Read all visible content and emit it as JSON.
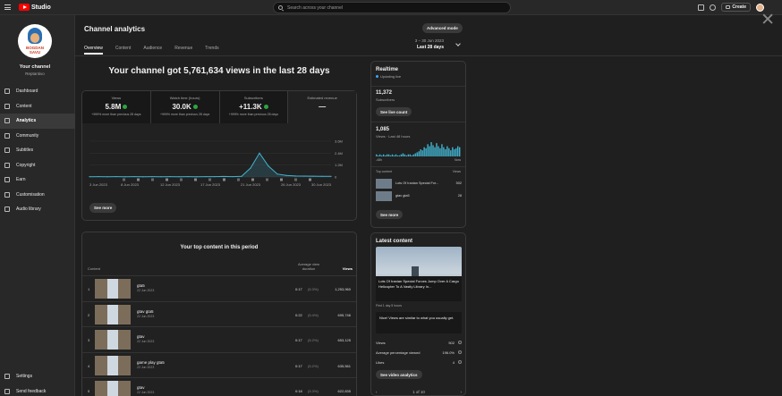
{
  "app": {
    "logo_text": "Studio",
    "search_placeholder": "Search across your channel",
    "create_label": "Create",
    "brand_color": "#ff0000"
  },
  "sidebar": {
    "avatar_text_line1": "BOGDAN",
    "avatar_text_line2": "SAVU",
    "your_channel": "Your channel",
    "channel_name": "Reptantivo",
    "items": [
      {
        "label": "Dashboard",
        "icon": "dashboard-icon"
      },
      {
        "label": "Content",
        "icon": "content-icon"
      },
      {
        "label": "Analytics",
        "icon": "analytics-icon",
        "active": true
      },
      {
        "label": "Community",
        "icon": "community-icon"
      },
      {
        "label": "Subtitles",
        "icon": "subtitles-icon"
      },
      {
        "label": "Copyright",
        "icon": "copyright-icon"
      },
      {
        "label": "Earn",
        "icon": "earn-icon"
      },
      {
        "label": "Customisation",
        "icon": "customisation-icon"
      },
      {
        "label": "Audio library",
        "icon": "audio-library-icon"
      }
    ],
    "bottom_items": [
      {
        "label": "Settings",
        "icon": "settings-icon"
      },
      {
        "label": "Send feedback",
        "icon": "feedback-icon"
      }
    ]
  },
  "main": {
    "title": "Channel analytics",
    "tabs": [
      "Overview",
      "Content",
      "Audience",
      "Revenue",
      "Trends"
    ],
    "advanced_mode": "Advanced mode",
    "date_range": "3 – 30 Jun 2023",
    "date_label": "Last 28 days",
    "headline": "Your channel got 5,761,634 views in the last 28 days",
    "metrics": [
      {
        "label": "Views",
        "value": "5.8M",
        "sub": "+999% more than previous 28 days"
      },
      {
        "label": "Watch time (hours)",
        "value": "30.0K",
        "sub": "+999% more than previous 28 days"
      },
      {
        "label": "Subscribers",
        "value": "+11.3K",
        "sub": "+999% more than previous 28 days"
      },
      {
        "label": "Estimated revenue",
        "value": "—",
        "sub": ""
      }
    ],
    "see_more": "See more"
  },
  "chart_data": {
    "type": "line",
    "x_ticks": [
      "3 Jun 2023",
      "8 Jun 2023",
      "12 Jun 2023",
      "17 Jun 2023",
      "21 Jun 2023",
      "26 Jun 2023",
      "30 Jun 2023"
    ],
    "y_ticks": [
      "0",
      "1.2M",
      "2.4M",
      "3.6M"
    ],
    "ylim": [
      0,
      3600000
    ],
    "x": [
      1,
      2,
      3,
      4,
      5,
      6,
      7,
      8,
      9,
      10,
      11,
      12,
      13,
      14,
      15,
      16,
      17,
      18,
      19,
      20,
      21,
      22,
      23,
      24,
      25,
      26,
      27,
      28
    ],
    "values": [
      30000,
      40000,
      30000,
      40000,
      30000,
      40000,
      30000,
      40000,
      30000,
      40000,
      30000,
      40000,
      30000,
      40000,
      40000,
      50000,
      40000,
      60000,
      900000,
      2400000,
      1100000,
      300000,
      150000,
      100000,
      90000,
      80000,
      70000,
      60000
    ],
    "series_color": "#41b4d0",
    "grid": true
  },
  "top_content": {
    "title": "Your top content in this period",
    "col_content": "Content",
    "col_avg": "Average view duration",
    "col_views": "Views",
    "rows": [
      {
        "idx": "1",
        "title": "gta5",
        "date": "22 Jun 2023",
        "dur": "0:17",
        "pct": "(5.3%)",
        "views": "1,253,960"
      },
      {
        "idx": "2",
        "title": "gtav gta5",
        "date": "22 Jun 2023",
        "dur": "0:22",
        "pct": "(5.4%)",
        "views": "695,746"
      },
      {
        "idx": "3",
        "title": "gtav",
        "date": "22 Jun 2023",
        "dur": "0:17",
        "pct": "(5.2%)",
        "views": "653,125"
      },
      {
        "idx": "4",
        "title": "game play gta5",
        "date": "22 Jun 2023",
        "dur": "0:17",
        "pct": "(5.2%)",
        "views": "635,561"
      },
      {
        "idx": "5",
        "title": "gtav",
        "date": "22 Jun 2023",
        "dur": "0:18",
        "pct": "(5.3%)",
        "views": "622,835"
      }
    ]
  },
  "realtime": {
    "title": "Realtime",
    "updating": "Updating live",
    "subs_value": "11,372",
    "subs_label": "Subscribers",
    "see_live": "See live count",
    "views_value": "1,085",
    "views_label": "Views · Last 48 hours",
    "x_left": "-48h",
    "x_right": "Now",
    "bars": [
      2,
      1,
      2,
      1,
      2,
      1,
      2,
      2,
      1,
      2,
      1,
      2,
      1,
      1,
      2,
      3,
      2,
      1,
      2,
      2,
      1,
      2,
      3,
      4,
      5,
      7,
      6,
      9,
      8,
      12,
      10,
      14,
      11,
      9,
      13,
      10,
      8,
      12,
      9,
      7,
      10,
      8,
      6,
      9,
      7,
      8,
      10,
      9
    ],
    "top_content_label": "Top content",
    "views_col": "Views",
    "top_items": [
      {
        "title": "Lots Of Iranian Special For...",
        "views": "502"
      },
      {
        "title": "gtav gta5",
        "views": "28"
      }
    ],
    "see_more": "See more"
  },
  "latest": {
    "title": "Latest content",
    "video_title": "Lots Of Iranian Special Forces Jump Over A Cargo Helicopter To A Vastly Library In...",
    "first_period": "First 1 day 5 hours",
    "nice_msg": "Nice! Views are similar to what you usually get.",
    "stats": [
      {
        "label": "Views",
        "value": "502"
      },
      {
        "label": "Average percentage viewed",
        "value": "196.0%"
      },
      {
        "label": "Likes",
        "value": "4"
      }
    ],
    "see_analytics": "See video analytics",
    "pager": "1 of 10"
  }
}
